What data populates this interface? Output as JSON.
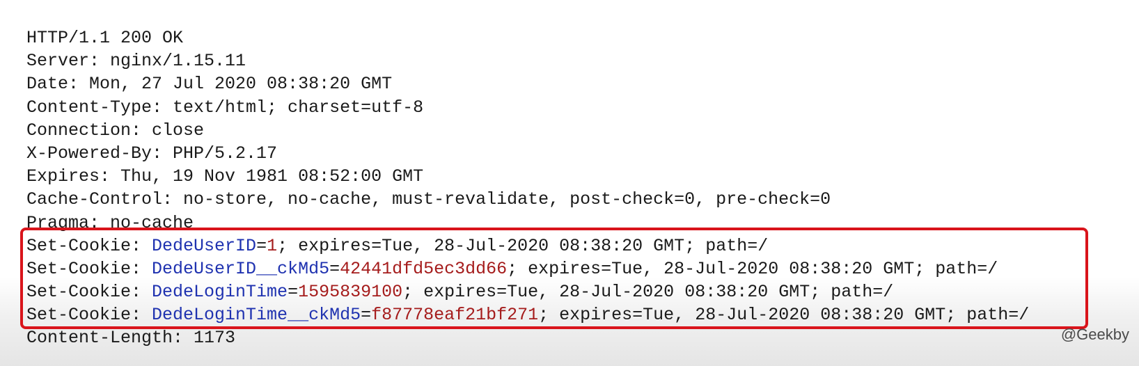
{
  "status_line": "HTTP/1.1 200 OK",
  "headers": [
    "Server: nginx/1.15.11",
    "Date: Mon, 27 Jul 2020 08:38:20 GMT",
    "Content-Type: text/html; charset=utf-8",
    "Connection: close",
    "X-Powered-By: PHP/5.2.17",
    "Expires: Thu, 19 Nov 1981 08:52:00 GMT",
    "Cache-Control: no-store, no-cache, must-revalidate, post-check=0, pre-check=0",
    "Pragma: no-cache"
  ],
  "set_cookies": [
    {
      "prefix": "Set-Cookie: ",
      "name": "DedeUserID",
      "eq": "=",
      "value": "1",
      "attrs": "; expires=Tue, 28-Jul-2020 08:38:20 GMT; path=/"
    },
    {
      "prefix": "Set-Cookie: ",
      "name": "DedeUserID__ckMd5",
      "eq": "=",
      "value": "42441dfd5ec3dd66",
      "attrs": "; expires=Tue, 28-Jul-2020 08:38:20 GMT; path=/"
    },
    {
      "prefix": "Set-Cookie: ",
      "name": "DedeLoginTime",
      "eq": "=",
      "value": "1595839100",
      "attrs": "; expires=Tue, 28-Jul-2020 08:38:20 GMT; path=/"
    },
    {
      "prefix": "Set-Cookie: ",
      "name": "DedeLoginTime__ckMd5",
      "eq": "=",
      "value": "f87778eaf21bf271",
      "attrs": "; expires=Tue, 28-Jul-2020 08:38:20 GMT; path=/"
    }
  ],
  "content_length": "Content-Length: 1173",
  "watermark": "@Geekby",
  "colors": {
    "cookie_name": "#1f32b0",
    "cookie_value": "#a51c1c",
    "highlight_border": "#d9141b"
  }
}
